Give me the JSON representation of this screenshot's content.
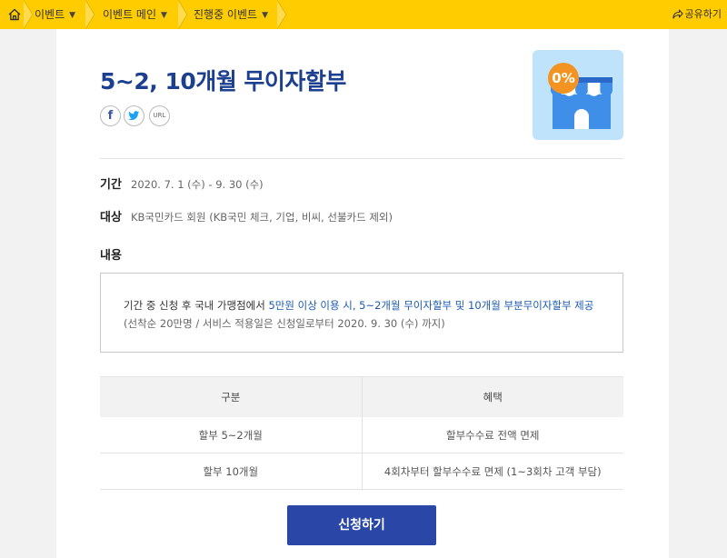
{
  "topbar": {
    "crumbs": [
      "이벤트",
      "이벤트 메인",
      "진행중 이벤트"
    ],
    "share_label": "공유하기",
    "bg_color": "#ffcc00"
  },
  "event": {
    "title": "5~2, 10개월 무이자할부",
    "sns": {
      "facebook": "f",
      "url": "URL"
    },
    "badge": "0%",
    "period_label": "기간",
    "period_value": "2020. 7. 1 (수) - 9. 30 (수)",
    "target_label": "대상",
    "target_value": "KB국민카드 회원 (KB국민 체크, 기업, 비씨, 선불카드 제외)",
    "content_label": "내용",
    "content_line1_pre": "기간 중 신청 후 국내 가맹점에서 ",
    "content_line1_hl": "5만원 이상 이용 시, 5~2개월 무이자할부 및 10개월 부분무이자할부 제공",
    "content_line2": "(선착순 20만명 / 서비스 적용일은 신청일로부터 2020. 9. 30 (수) 까지)"
  },
  "table": {
    "headers": [
      "구분",
      "혜택"
    ],
    "rows": [
      [
        "할부 5~2개월",
        "할부수수료 전액 면제"
      ],
      [
        "할부 10개월",
        "4회차부터 할부수수료 면제 (1~3회차 고객 부담)"
      ]
    ]
  },
  "apply_button": "신청하기",
  "colors": {
    "accent": "#2a47a8",
    "title": "#1d3f8f",
    "highlight": "#1d5ab0"
  }
}
